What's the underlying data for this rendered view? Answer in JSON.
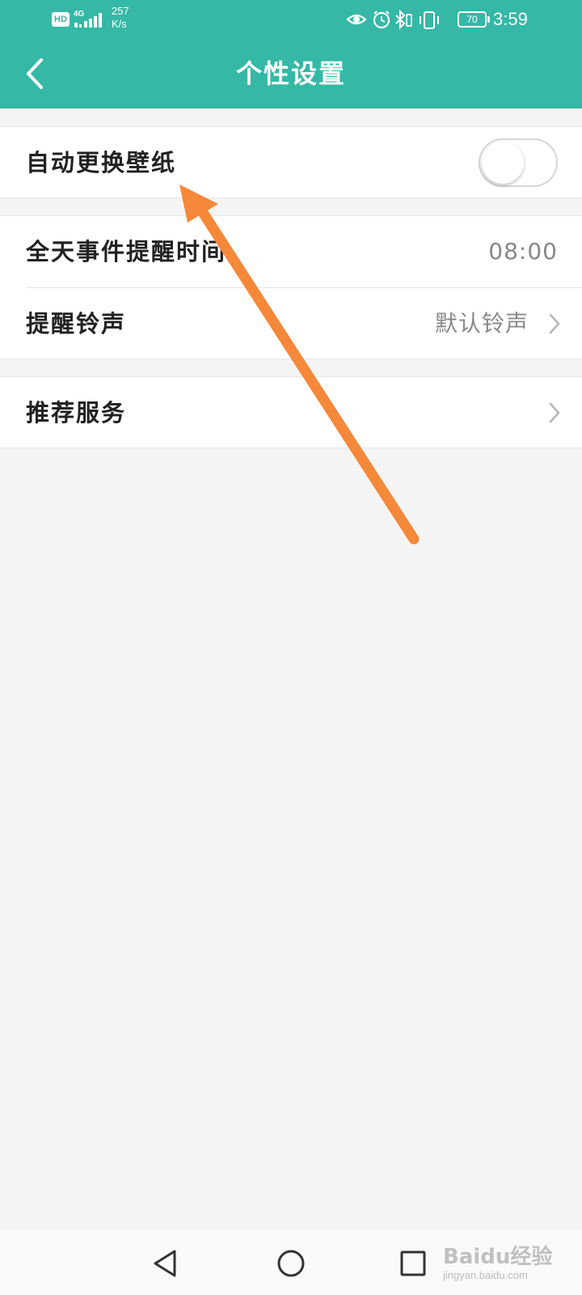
{
  "status_bar": {
    "hd_label": "HD",
    "network_label": "4G",
    "speed_value": "257",
    "speed_unit": "K/s",
    "battery_level": "70",
    "time": "3:59",
    "icons": [
      "eye-icon",
      "alarm-icon",
      "bluetooth-icon",
      "vibrate-icon",
      "battery-icon"
    ]
  },
  "header": {
    "title": "个性设置",
    "back_icon": "chevron-left-icon",
    "background_color": "#35b8a6"
  },
  "settings": {
    "auto_wallpaper": {
      "label": "自动更换壁纸",
      "enabled": false
    },
    "all_day_reminder_time": {
      "label": "全天事件提醒时间",
      "value": "08:00"
    },
    "reminder_ringtone": {
      "label": "提醒铃声",
      "value": "默认铃声"
    },
    "recommended_services": {
      "label": "推荐服务"
    }
  },
  "annotation": {
    "color": "#f6883a",
    "icon": "arrow-icon"
  },
  "nav_bar": {
    "buttons": [
      "back-triangle-icon",
      "home-circle-icon",
      "recents-square-icon"
    ]
  },
  "watermark": {
    "logo": "Baidu经验",
    "url": "jingyan.baidu.com"
  }
}
